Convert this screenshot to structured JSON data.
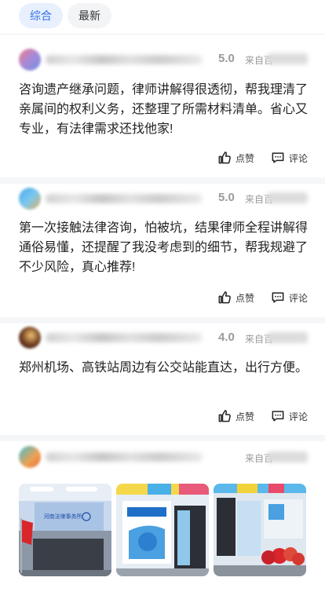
{
  "tabs": [
    {
      "label": "综合",
      "active": true
    },
    {
      "label": "最新",
      "active": false
    }
  ],
  "reviews": [
    {
      "rating": "5.0",
      "source": "来自百",
      "content": "咨询遗产继承问题，律师讲解得很透彻，帮我理清了亲属间的权利义务，还整理了所需材料清单。省心又专业，有法律需求还找他家!",
      "like_label": "点赞",
      "comment_label": "评论"
    },
    {
      "rating": "5.0",
      "source": "来自百",
      "content": "第一次接触法律咨询，怕被坑，结果律师全程讲解得通俗易懂，还提醒了我没考虑到的细节，帮我规避了不少风险，真心推荐!",
      "like_label": "点赞",
      "comment_label": "评论"
    },
    {
      "rating": "4.0",
      "source": "来自百",
      "content": "郑州机场、高铁站周边有公交站能直达，出行方便。",
      "like_label": "点赞",
      "comment_label": "评论"
    },
    {
      "rating": "",
      "source": "来自百"
    }
  ],
  "photo_sign_text": "河南法律事务所",
  "colors": {
    "accent": "#2f6fe8",
    "active_tab_bg": "#e8f0fe",
    "muted": "#9a9a9a",
    "flag_red": "#d8262b"
  }
}
